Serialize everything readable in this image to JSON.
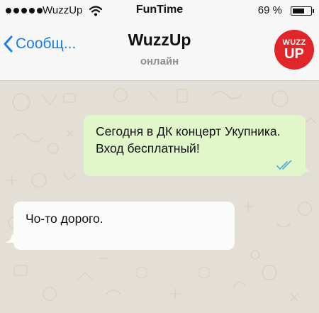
{
  "status_bar": {
    "carrier": "WuzzUp",
    "time": "FunTime",
    "battery_percent": "69 %",
    "battery_level": 0.69,
    "icons": [
      "signal-dots-icon",
      "wifi-icon",
      "battery-icon"
    ]
  },
  "header": {
    "back_label": "Сообщ...",
    "title": "WuzzUp",
    "status": "онлайн",
    "avatar": {
      "line1": "WUZZ",
      "line2": "UP"
    },
    "colors": {
      "accent": "#1a7ee6",
      "avatar_bg": "#e0262a"
    }
  },
  "messages": [
    {
      "direction": "outgoing",
      "text": "Сегодня в ДК концерт Укупника. Вход бесплатный!",
      "status": "read"
    },
    {
      "direction": "incoming",
      "text": "Чо-то дорого."
    }
  ],
  "colors": {
    "outgoing_bubble": "#e1f7ca",
    "incoming_bubble": "#fbfbfb",
    "chat_background": "#e4dfd6",
    "read_ticks": "#4fb0e6"
  }
}
